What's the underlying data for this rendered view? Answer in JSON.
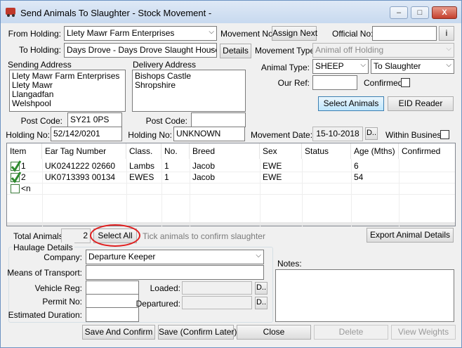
{
  "window": {
    "title": "Send Animals To Slaughter - Stock Movement -",
    "minimize": "–",
    "maximize": "□",
    "close": "X"
  },
  "holding": {
    "from_label": "From Holding:",
    "from_value": "Llety Mawr Farm Enterprises",
    "to_label": "To Holding:",
    "to_value": "Days Drove - Days Drove Slaught House",
    "details_button": "Details",
    "movement_no_label": "Movement No:",
    "assign_next_button": "Assign Next",
    "official_no_label": "Official No:",
    "official_no_value": "",
    "info_button": "i",
    "movement_type_label": "Movement Type:",
    "movement_type_value": "Animal off Holding",
    "animal_type_label": "Animal Type:",
    "animal_type_value": "SHEEP",
    "destination_value": "To Slaughter",
    "our_ref_label": "Our Ref:",
    "our_ref_value": "",
    "confirmed_label": "Confirmed:",
    "select_animals_button": "Select Animals",
    "eid_reader_button": "EID Reader"
  },
  "sending": {
    "label": "Sending Address",
    "lines": [
      "Llety Mawr Farm Enterprises",
      "Llety Mawr",
      "Llangadfan",
      "Welshpool"
    ],
    "postcode_label": "Post Code:",
    "postcode_value": "SY21 0PS",
    "holding_no_label": "Holding No:",
    "holding_no_value": "52/142/0201"
  },
  "delivery": {
    "label": "Delivery Address",
    "lines": [
      "Bishops Castle",
      "Shropshire"
    ],
    "postcode_label": "Post Code:",
    "postcode_value": "",
    "holding_no_label": "Holding No:",
    "holding_no_value": "UNKNOWN"
  },
  "movement_date": {
    "label": "Movement Date:",
    "value": "15-10-2018",
    "picker_button": "D.."
  },
  "within_business_label": "Within Business",
  "grid": {
    "columns": [
      "Item",
      "Ear Tag Number",
      "Class.",
      "No.",
      "Breed",
      "Sex",
      "Status",
      "Age (Mths)",
      "Confirmed"
    ],
    "rows": [
      {
        "item": "1",
        "ear_tag": "UK0241222 02660",
        "class": "Lambs",
        "no": "1",
        "breed": "Jacob",
        "sex": "EWE",
        "status": "",
        "age": "6",
        "confirmed": ""
      },
      {
        "item": "2",
        "ear_tag": "UK0713393 00134",
        "class": "EWES",
        "no": "1",
        "breed": "Jacob",
        "sex": "EWE",
        "status": "",
        "age": "54",
        "confirmed": ""
      }
    ],
    "new_row_label": "<n"
  },
  "totals": {
    "label": "Total Animals:",
    "value": "2",
    "select_all_button": "Select All",
    "hint": "Tick animals to confirm slaughter",
    "export_button": "Export Animal Details"
  },
  "haulage": {
    "label": "Haulage Details",
    "company_label": "Company:",
    "company_value": "Departure Keeper",
    "transport_label": "Means of Transport:",
    "transport_value": "",
    "vehicle_reg_label": "Vehicle Reg:",
    "vehicle_reg_value": "",
    "permit_label": "Permit No:",
    "permit_value": "",
    "duration_label": "Estimated Duration:",
    "duration_value": "",
    "loaded_label": "Loaded:",
    "loaded_value": "",
    "departured_label": "Departured:",
    "departured_value": "",
    "picker_button": "D.."
  },
  "notes": {
    "label": "Notes:",
    "value": ""
  },
  "footer": {
    "save_confirm_button": "Save And Confirm",
    "save_later_button": "Save (Confirm Later)",
    "close_button": "Close",
    "delete_button": "Delete",
    "view_weights_button": "View Weights"
  },
  "icons": {
    "dropdown": "▼",
    "tick": "check-mark-icon"
  },
  "colors": {
    "highlight_circle": "#e02020",
    "accent_button": "#bee6fd",
    "tick": "#2e8b2e"
  }
}
